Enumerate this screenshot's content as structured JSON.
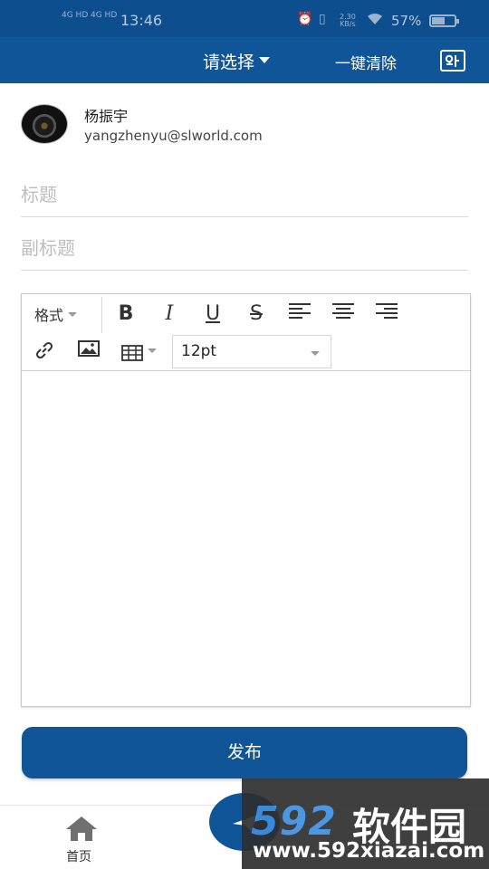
{
  "status_bar": {
    "net1": "4G HD",
    "net2": "4G HD",
    "time": "13:46",
    "speed_value": "2.30",
    "speed_unit": "KB/s",
    "battery_text": "57%",
    "battery_level": 0.57
  },
  "header": {
    "select_label": "请选择",
    "clear_label": "一键清除"
  },
  "author": {
    "name": "杨振宇",
    "email": "yangzhenyu@slworld.com"
  },
  "form": {
    "title_placeholder": "标题",
    "subtitle_placeholder": "副标题"
  },
  "toolbar": {
    "format_label": "格式",
    "bold": "B",
    "italic": "I",
    "underline": "U",
    "strike": "S",
    "font_size": "12pt"
  },
  "actions": {
    "publish_label": "发布"
  },
  "nav": {
    "home_label": "首页"
  },
  "watermark": {
    "logo": "592",
    "cn": "软件园",
    "url": "www.592xiazai.com"
  },
  "colors": {
    "primary": "#0f5597",
    "status_bar": "#0d4e8f"
  }
}
